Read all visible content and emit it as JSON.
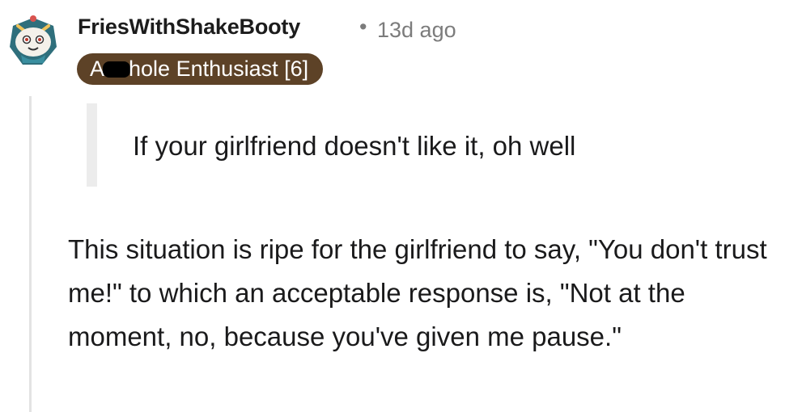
{
  "comment": {
    "author": "FriesWithShakeBooty",
    "separator": "•",
    "timestamp": "13d ago",
    "flair": {
      "prefix": "A",
      "suffix": "hole Enthusiast [6]",
      "color": "#5d4227",
      "redacted": true
    },
    "avatar_icon": "snoo-avatar-icon",
    "quote": "If your girlfriend doesn't like it, oh well",
    "body": "This situation is ripe for the girlfriend to say, \"You don't trust me!\" to which an acceptable response is, \"Not at the moment, no, because you've given me pause.\""
  }
}
